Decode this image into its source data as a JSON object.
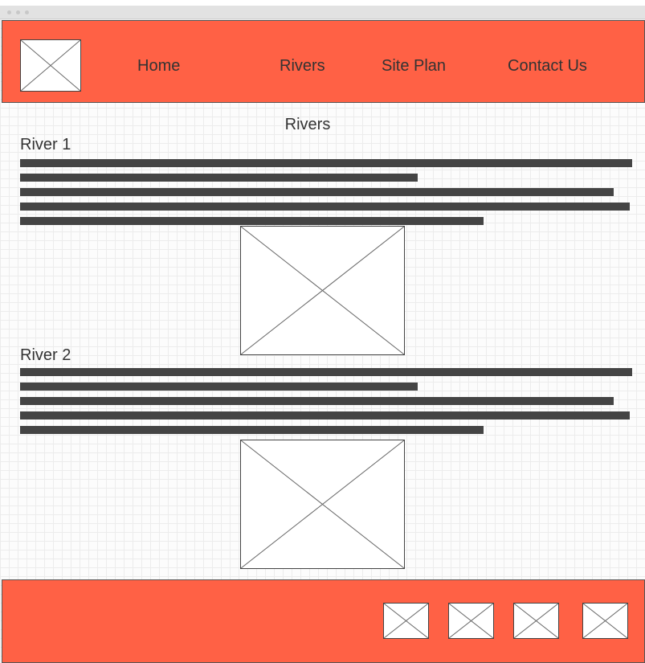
{
  "header": {
    "logo_icon": "image-placeholder-icon",
    "nav": [
      {
        "label": "Home"
      },
      {
        "label": "Rivers"
      },
      {
        "label": "Site Plan"
      },
      {
        "label": "Contact Us"
      }
    ]
  },
  "main": {
    "page_title": "Rivers",
    "sections": [
      {
        "title": "River 1",
        "image_icon": "image-placeholder-icon"
      },
      {
        "title": "River 2",
        "image_icon": "image-placeholder-icon"
      }
    ]
  },
  "footer": {
    "social_icons": [
      "image-placeholder-icon",
      "image-placeholder-icon",
      "image-placeholder-icon",
      "image-placeholder-icon"
    ]
  },
  "colors": {
    "accent": "#ff6145",
    "text_bar": "#444444"
  }
}
